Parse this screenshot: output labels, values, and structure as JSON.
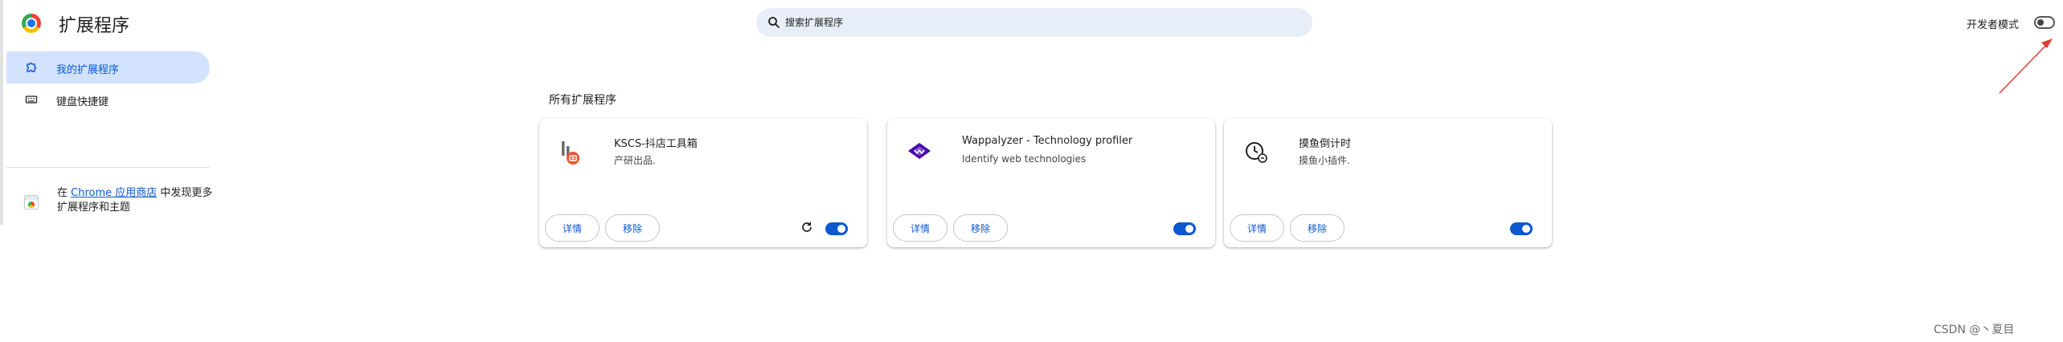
{
  "header": {
    "title": "扩展程序",
    "search_placeholder": "搜索扩展程序",
    "dev_mode_label": "开发者模式",
    "dev_mode_enabled": false
  },
  "sidebar": {
    "items": [
      {
        "label": "我的扩展程序",
        "icon": "puzzle-icon",
        "active": true
      },
      {
        "label": "键盘快捷键",
        "icon": "keyboard-icon",
        "active": false
      }
    ],
    "store": {
      "prefix": "在 ",
      "link": "Chrome 应用商店",
      "suffix": " 中发现更多扩展程序和主题"
    }
  },
  "main": {
    "section_title": "所有扩展程序",
    "extensions": [
      {
        "name": "KSCS-抖店工具箱",
        "description": "产研出品.",
        "details_label": "详情",
        "remove_label": "移除",
        "enabled": true,
        "has_reload": true
      },
      {
        "name": "Wappalyzer - Technology profiler",
        "description": "Identify web technologies",
        "details_label": "详情",
        "remove_label": "移除",
        "enabled": true,
        "has_reload": false
      },
      {
        "name": "摸鱼倒计时",
        "description": "摸鱼小插件.",
        "details_label": "详情",
        "remove_label": "移除",
        "enabled": true,
        "has_reload": false
      }
    ]
  },
  "watermark": "CSDN @丶夏目",
  "colors": {
    "accent": "#0b57d0",
    "active_nav_bg": "#d3e3fd",
    "search_bg": "#e8eef7",
    "annotation_arrow": "#e53935"
  }
}
